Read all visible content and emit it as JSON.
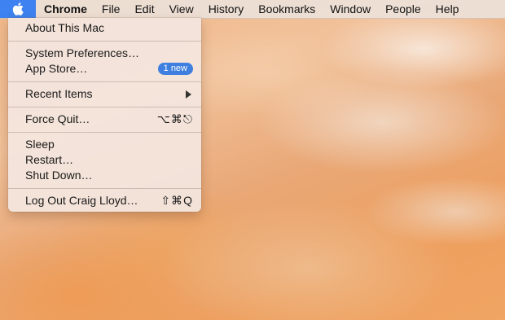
{
  "menubar": {
    "apple_icon": "apple-logo-icon",
    "app_name": "Chrome",
    "menus": [
      "File",
      "Edit",
      "View",
      "History",
      "Bookmarks",
      "Window",
      "People",
      "Help"
    ]
  },
  "apple_menu": {
    "about": "About This Mac",
    "system_preferences": "System Preferences…",
    "app_store": "App Store…",
    "app_store_badge": "1 new",
    "recent_items": "Recent Items",
    "recent_items_icon": "submenu-arrow-icon",
    "force_quit": "Force Quit…",
    "force_quit_shortcut": "⌥⌘⎋",
    "sleep": "Sleep",
    "restart": "Restart…",
    "shut_down": "Shut Down…",
    "log_out": "Log Out Craig Lloyd…",
    "log_out_shortcut": "⇧⌘Q"
  },
  "colors": {
    "apple_tab": "#3d82f0",
    "badge": "#3f7fe0"
  }
}
